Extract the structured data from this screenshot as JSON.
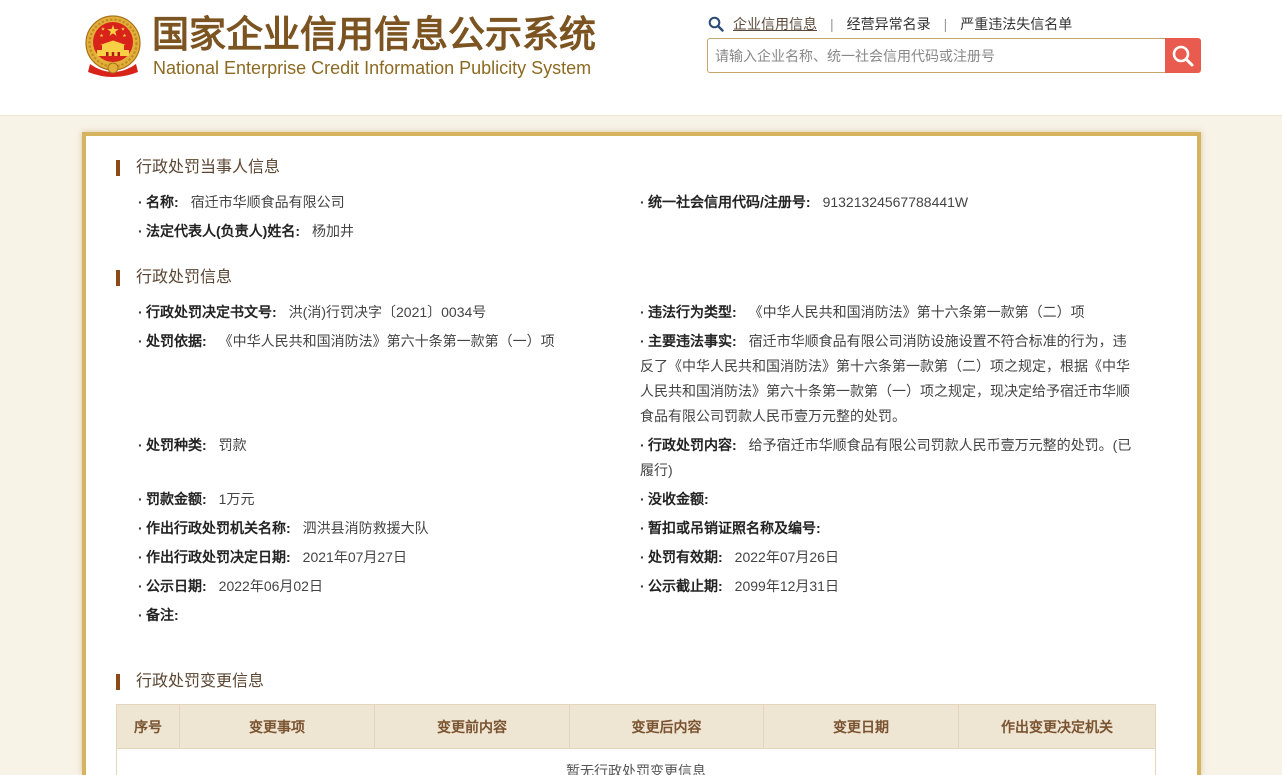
{
  "header": {
    "emblem_icon": "national-emblem-icon",
    "title_cn": "国家企业信用信息公示系统",
    "title_en": "National Enterprise Credit Information Publicity System",
    "nav_icon": "search-icon",
    "nav": [
      {
        "label": "企业信用信息",
        "active": true
      },
      {
        "label": "经营异常名录",
        "active": false
      },
      {
        "label": "严重违法失信名单",
        "active": false
      }
    ],
    "nav_separator": "|",
    "search": {
      "placeholder": "请输入企业名称、统一社会信用代码或注册号",
      "value": "",
      "button_icon": "search-icon"
    }
  },
  "party_section": {
    "title": "行政处罚当事人信息",
    "rows": [
      [
        {
          "label": "名称:",
          "value": "宿迁市华顺食品有限公司"
        },
        {
          "label": "统一社会信用代码/注册号:",
          "value": "91321324567788441W"
        }
      ],
      [
        {
          "label": "法定代表人(负责人)姓名:",
          "value": "杨加井"
        }
      ]
    ]
  },
  "penalty_section": {
    "title": "行政处罚信息",
    "rows": [
      [
        {
          "label": "行政处罚决定书文号:",
          "value": "洪(消)行罚决字〔2021〕0034号"
        },
        {
          "label": "违法行为类型:",
          "value": "《中华人民共和国消防法》第十六条第一款第（二）项"
        }
      ],
      [
        {
          "label": "处罚依据:",
          "value": "《中华人民共和国消防法》第六十条第一款第（一）项"
        },
        {
          "label": "主要违法事实:",
          "value": "宿迁市华顺食品有限公司消防设施设置不符合标准的行为，违反了《中华人民共和国消防法》第十六条第一款第（二）项之规定，根据《中华人民共和国消防法》第六十条第一款第（一）项之规定，现决定给予宿迁市华顺食品有限公司罚款人民币壹万元整的处罚。"
        }
      ],
      [
        {
          "label": "处罚种类:",
          "value": "罚款"
        },
        {
          "label": "行政处罚内容:",
          "value": "给予宿迁市华顺食品有限公司罚款人民币壹万元整的处罚。(已履行)"
        }
      ],
      [
        {
          "label": "罚款金额:",
          "value": "1万元"
        },
        {
          "label": "没收金额:",
          "value": ""
        }
      ],
      [
        {
          "label": "作出行政处罚机关名称:",
          "value": "泗洪县消防救援大队"
        },
        {
          "label": "暂扣或吊销证照名称及编号:",
          "value": ""
        }
      ],
      [
        {
          "label": "作出行政处罚决定日期:",
          "value": "2021年07月27日"
        },
        {
          "label": "处罚有效期:",
          "value": "2022年07月26日"
        }
      ],
      [
        {
          "label": "公示日期:",
          "value": "2022年06月02日"
        },
        {
          "label": "公示截止期:",
          "value": "2099年12月31日"
        }
      ],
      [
        {
          "label": "备注:",
          "value": ""
        }
      ]
    ]
  },
  "change_section": {
    "title": "行政处罚变更信息",
    "columns": [
      "序号",
      "变更事项",
      "变更前内容",
      "变更后内容",
      "变更日期",
      "作出变更决定机关"
    ],
    "empty_text": "暂无行政处罚变更信息"
  },
  "colors": {
    "brand_title": "#7b5421",
    "search_button": "#e85b4e",
    "card_border": "#d6b35f",
    "page_background": "#f8f3e7",
    "section_bar": "#8b4a16",
    "table_header_background": "#efe5d3"
  }
}
